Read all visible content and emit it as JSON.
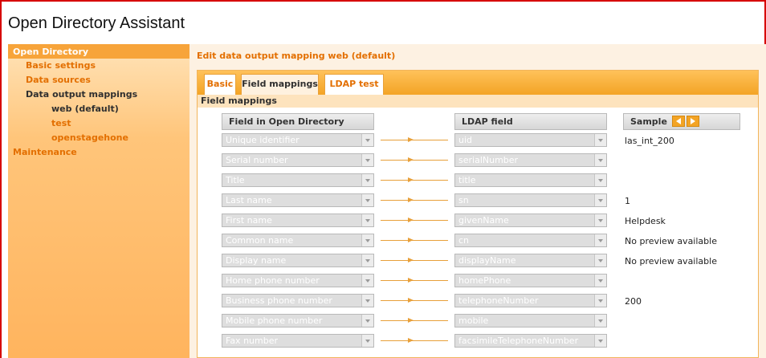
{
  "app": {
    "title": "Open Directory Assistant"
  },
  "sidebar": {
    "header": "Open Directory",
    "items": [
      {
        "label": "Basic settings",
        "level": 1,
        "selected": false
      },
      {
        "label": "Data sources",
        "level": 1,
        "selected": false
      },
      {
        "label": "Data output mappings",
        "level": 1,
        "selected": true
      },
      {
        "label": "web (default)",
        "level": 2,
        "selected": true
      },
      {
        "label": "test",
        "level": 2,
        "selected": false
      },
      {
        "label": "openstagehone",
        "level": 2,
        "selected": false
      },
      {
        "label": "Maintenance",
        "level": 0,
        "selected": false
      }
    ]
  },
  "main": {
    "title": "Edit data output mapping web (default)",
    "tabs": [
      {
        "label": "Basic",
        "active": false
      },
      {
        "label": "Field mappings",
        "active": true
      },
      {
        "label": "LDAP test",
        "active": false
      }
    ],
    "section_title": "Field mappings",
    "columns": {
      "od_field": "Field in Open Directory",
      "ldap_field": "LDAP field",
      "sample": "Sample"
    },
    "rows": [
      {
        "od": "Unique identifier",
        "ldap": "uid",
        "sample": "las_int_200"
      },
      {
        "od": "Serial number",
        "ldap": "serialNumber",
        "sample": ""
      },
      {
        "od": "Title",
        "ldap": "title",
        "sample": ""
      },
      {
        "od": "Last name",
        "ldap": "sn",
        "sample": "1"
      },
      {
        "od": "First name",
        "ldap": "givenName",
        "sample": "Helpdesk"
      },
      {
        "od": "Common name",
        "ldap": "cn",
        "sample": "No preview available"
      },
      {
        "od": "Display name",
        "ldap": "displayName",
        "sample": "No preview available"
      },
      {
        "od": "Home phone number",
        "ldap": "homePhone",
        "sample": ""
      },
      {
        "od": "Business phone number",
        "ldap": "telephoneNumber",
        "sample": "200"
      },
      {
        "od": "Mobile phone number",
        "ldap": "mobile",
        "sample": ""
      },
      {
        "od": "Fax number",
        "ldap": "facsimileTelephoneNumber",
        "sample": ""
      }
    ]
  },
  "colors": {
    "accent": "#e36f00",
    "tab_bar": "#f3a425",
    "frame": "#d60000"
  }
}
